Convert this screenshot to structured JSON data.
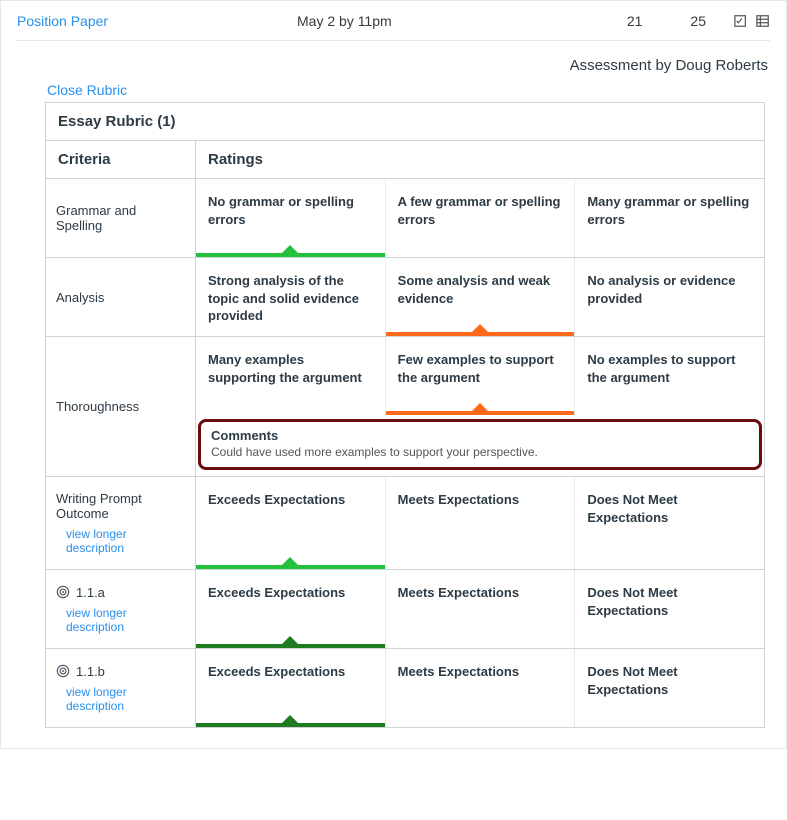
{
  "topbar": {
    "assignment": "Position Paper",
    "due": "May 2 by 11pm",
    "score": "21",
    "outof": "25"
  },
  "assessment_by": "Assessment by Doug Roberts",
  "close_label": "Close Rubric",
  "rubric_title": "Essay Rubric (1)",
  "head_criteria": "Criteria",
  "head_ratings": "Ratings",
  "rows": [
    {
      "criterion": "Grammar and Spelling",
      "r0": "No grammar or spelling errors",
      "r1": "A few grammar or spelling errors",
      "r2": "Many grammar or spelling errors",
      "selected": 0,
      "color": "green"
    },
    {
      "criterion": "Analysis",
      "r0": "Strong analysis of the topic and solid evidence provided",
      "r1": "Some analysis and weak evidence",
      "r2": "No analysis or evidence provided",
      "selected": 1,
      "color": "orange"
    },
    {
      "criterion": "Thoroughness",
      "r0": "Many examples supporting the argument",
      "r1": "Few examples to support the argument",
      "r2": "No examples to support the argument",
      "selected": 1,
      "color": "orange",
      "comment_title": "Comments",
      "comment_text": "Could have used more examples to support your perspective."
    },
    {
      "criterion": "Writing Prompt Outcome",
      "view_longer": "view longer description",
      "r0": "Exceeds Expectations",
      "r1": "Meets Expectations",
      "r2": "Does Not Meet Expectations",
      "selected": 0,
      "color": "green"
    },
    {
      "criterion": "1.1.a",
      "has_icon": true,
      "view_longer": "view longer description",
      "r0": "Exceeds Expectations",
      "r1": "Meets Expectations",
      "r2": "Does Not Meet Expectations",
      "selected": 0,
      "color": "dgreen"
    },
    {
      "criterion": "1.1.b",
      "has_icon": true,
      "view_longer": "view longer description",
      "r0": "Exceeds Expectations",
      "r1": "Meets Expectations",
      "r2": "Does Not Meet Expectations",
      "selected": 0,
      "color": "dgreen"
    }
  ]
}
